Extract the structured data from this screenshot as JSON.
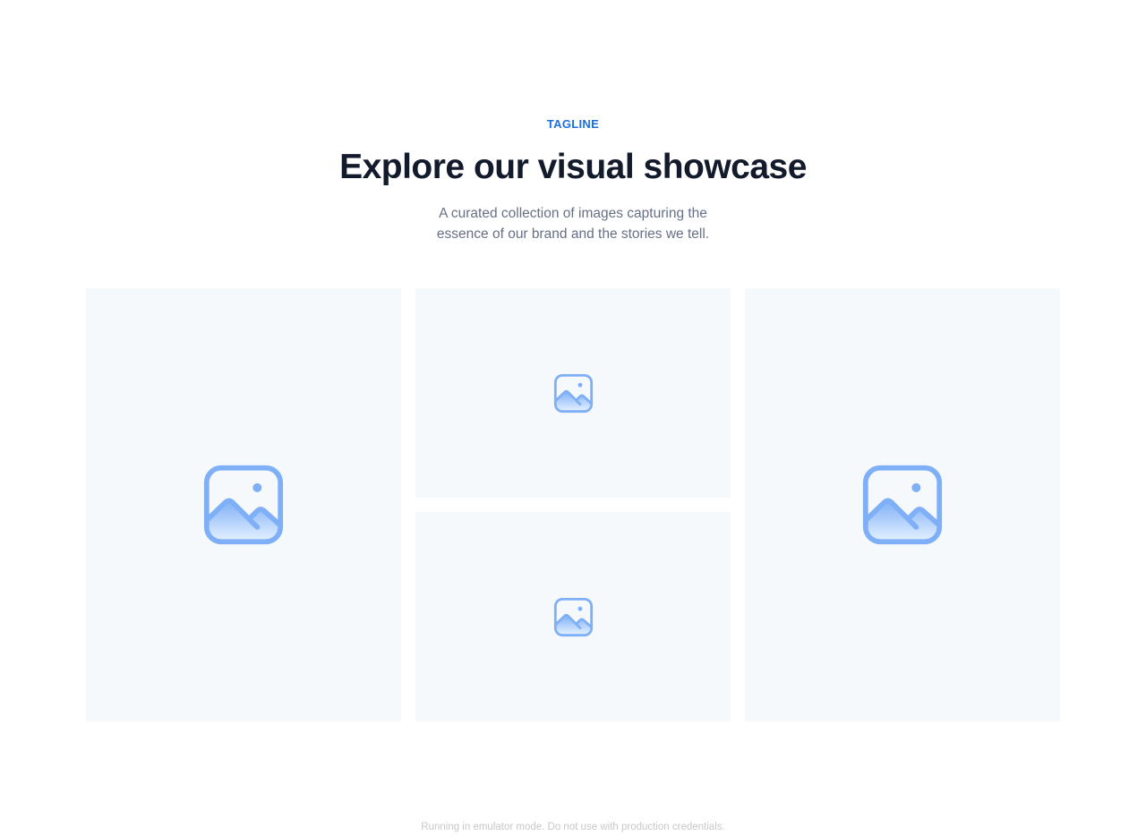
{
  "header": {
    "tagline": "TAGLINE",
    "title": "Explore our visual showcase",
    "subtitle": "A curated collection of images capturing the essence of our brand and the stories we tell."
  },
  "gallery": {
    "tiles": [
      {
        "icon": "image-placeholder-icon"
      },
      {
        "icon": "image-placeholder-icon"
      },
      {
        "icon": "image-placeholder-icon"
      },
      {
        "icon": "image-placeholder-icon"
      }
    ]
  },
  "footer": {
    "notice": "Running in emulator mode. Do not use with production credentials."
  },
  "colors": {
    "accent": "#1a6fe0",
    "title": "#121a2b",
    "subtitle": "#667085",
    "tile_background": "#f5f9fc",
    "icon_stroke": "#7fb0f7"
  }
}
